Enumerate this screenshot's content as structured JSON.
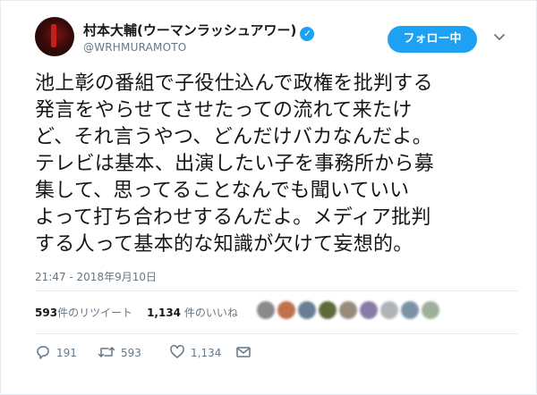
{
  "user": {
    "display_name": "村本大輔(ウーマンラッシュアワー)",
    "handle": "@WRHMURAMOTO",
    "verified": true
  },
  "follow_button": {
    "label": "フォロー中"
  },
  "tweet": {
    "text": "池上彰の番組で子役仕込んで政権を批判する\n発言をやらせてさせたっての流れて来たけ\nど、それ言うやつ、どんだけバカなんだよ。\nテレビは基本、出演したい子を事務所から募\n集して、思ってることなんでも聞いていい\nよって打ち合わせするんだよ。メディア批判\nする人って基本的な知識が欠けて妄想的。",
    "timestamp": "21:47 - 2018年9月10日"
  },
  "stats": {
    "retweets_count": "593",
    "retweets_label": "件のリツイート",
    "likes_count": "1,134",
    "likes_label": " 件のいいね"
  },
  "liker_avatar_colors": [
    "#8a8a8a",
    "#c0704a",
    "#6a7f95",
    "#5d6b3c",
    "#9a8a7c",
    "#8a7aa8",
    "#b0b4b8",
    "#7c93a6",
    "#9fb09a"
  ],
  "actions": {
    "reply_count": "191",
    "retweet_count": "593",
    "like_count": "1,134"
  },
  "colors": {
    "accent": "#1da1f2",
    "text": "#14171a",
    "muted": "#657786"
  }
}
